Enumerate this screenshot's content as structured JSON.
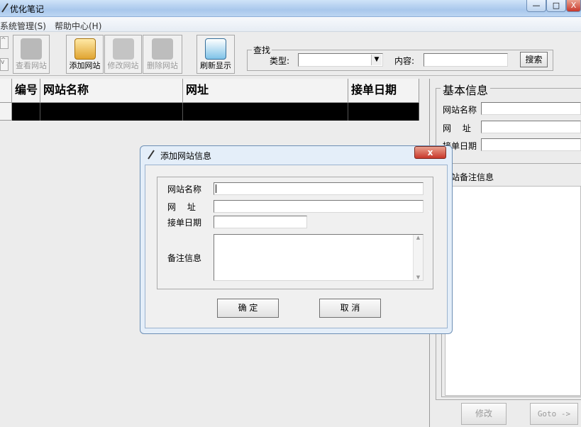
{
  "window": {
    "title": "优化笔记",
    "min": "—",
    "max": "□",
    "close": "X"
  },
  "menu": [
    {
      "label": "系统管理(S)"
    },
    {
      "label": "帮助中心(H)"
    }
  ],
  "toolbar": {
    "buttons": [
      {
        "label": "查看网站",
        "icon": "view-site-icon",
        "enabled": false
      },
      {
        "label": "添加网站",
        "icon": "add-site-icon",
        "enabled": true
      },
      {
        "label": "修改网站",
        "icon": "edit-site-icon",
        "enabled": false
      },
      {
        "label": "删除网站",
        "icon": "delete-site-icon",
        "enabled": false
      },
      {
        "label": "刷新显示",
        "icon": "refresh-icon",
        "enabled": true
      }
    ],
    "search": {
      "group_label": "查找",
      "type_label": "类型:",
      "type_value": "",
      "content_label": "内容:",
      "content_value": "",
      "button": "搜索"
    }
  },
  "grid": {
    "columns": [
      "编号",
      "网站名称",
      "网址",
      "接单日期"
    ]
  },
  "right_panel": {
    "group_label": "基本信息",
    "name_label": "网站名称",
    "url_label": "网　 址",
    "date_label": "接单日期",
    "note_label": "站备注信息",
    "edit_button": "修改",
    "goto_button": "Goto ->"
  },
  "dialog": {
    "title": "添加网站信息",
    "close": "x",
    "name_label": "网站名称",
    "name_value": "",
    "url_label": "网　 址",
    "url_value": "",
    "date_label": "接单日期",
    "date_value": "",
    "note_label": "备注信息",
    "note_value": "",
    "ok_button": "确 定",
    "cancel_button": "取 消"
  },
  "colors": {
    "title_bar": "#bcd5f2",
    "close_button": "#c8372b",
    "grid_selected_row": "#000000"
  }
}
